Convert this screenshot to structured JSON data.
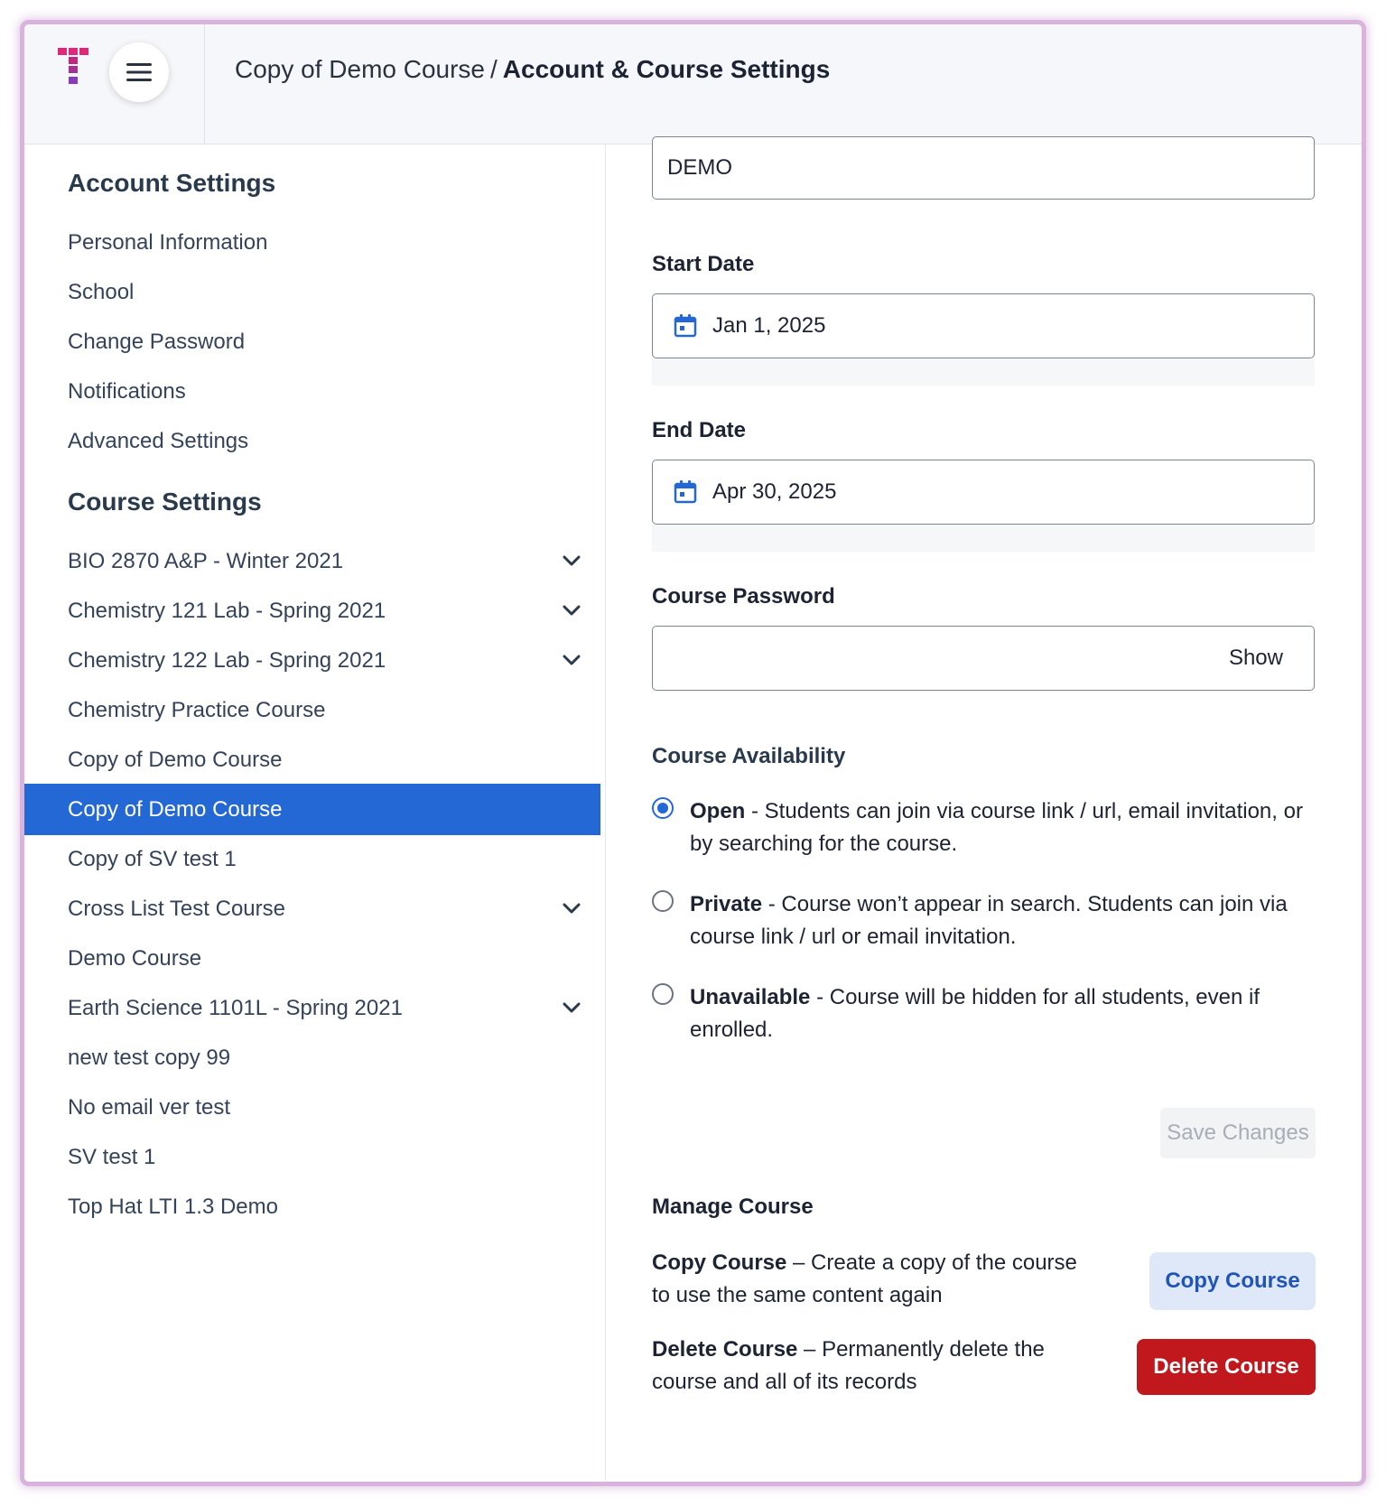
{
  "header": {
    "course_name": "Copy of Demo Course",
    "separator": "/",
    "page_title": "Account & Course Settings"
  },
  "sidebar": {
    "account_heading": "Account Settings",
    "account_items": [
      {
        "label": "Personal Information"
      },
      {
        "label": "School"
      },
      {
        "label": "Change Password"
      },
      {
        "label": "Notifications"
      },
      {
        "label": "Advanced Settings"
      }
    ],
    "course_heading": "Course Settings",
    "course_items": [
      {
        "label": "BIO 2870 A&P - Winter 2021",
        "expandable": true
      },
      {
        "label": "Chemistry 121 Lab - Spring 2021",
        "expandable": true
      },
      {
        "label": "Chemistry 122 Lab - Spring 2021",
        "expandable": true
      },
      {
        "label": "Chemistry Practice Course",
        "expandable": false
      },
      {
        "label": "Copy of Demo Course",
        "expandable": false
      },
      {
        "label": "Copy of Demo Course",
        "expandable": false,
        "selected": true
      },
      {
        "label": "Copy of SV test 1",
        "expandable": false
      },
      {
        "label": "Cross List Test Course",
        "expandable": true
      },
      {
        "label": "Demo Course",
        "expandable": false
      },
      {
        "label": "Earth Science 1101L - Spring 2021",
        "expandable": true
      },
      {
        "label": "new test copy 99",
        "expandable": false
      },
      {
        "label": "No email ver test",
        "expandable": false
      },
      {
        "label": "SV test 1",
        "expandable": false
      },
      {
        "label": "Top Hat LTI 1.3 Demo",
        "expandable": false
      }
    ]
  },
  "form": {
    "course_code_value": "DEMO",
    "start_date_label": "Start Date",
    "start_date_value": "Jan 1, 2025",
    "end_date_label": "End Date",
    "end_date_value": "Apr 30, 2025",
    "password_label": "Course Password",
    "password_value": "",
    "show_label": "Show",
    "availability_title": "Course Availability",
    "availability_options": [
      {
        "name": "Open",
        "description": " - Students can join via course link / url, email invitation, or by searching for the course.",
        "checked": true
      },
      {
        "name": "Private",
        "description": " - Course won’t appear in search. Students can join via course link / url or email invitation.",
        "checked": false
      },
      {
        "name": "Unavailable",
        "description": " - Course will be hidden for all students, even if enrolled.",
        "checked": false
      }
    ],
    "save_label": "Save Changes"
  },
  "manage": {
    "title": "Manage Course",
    "copy_name": "Copy Course",
    "copy_description": " – Create a copy of the course to use the same content again",
    "copy_button": "Copy Course",
    "delete_name": "Delete Course",
    "delete_description": " – Permanently delete the course and all of its records",
    "delete_button": "Delete Course"
  },
  "colors": {
    "accent": "#2468d6",
    "danger": "#c0181d",
    "logo_pink": "#e0287a",
    "logo_purple": "#8a3ab9"
  },
  "icons": {
    "menu": "hamburger-icon",
    "calendar": "calendar-icon",
    "expand": "chevron-down-icon"
  }
}
